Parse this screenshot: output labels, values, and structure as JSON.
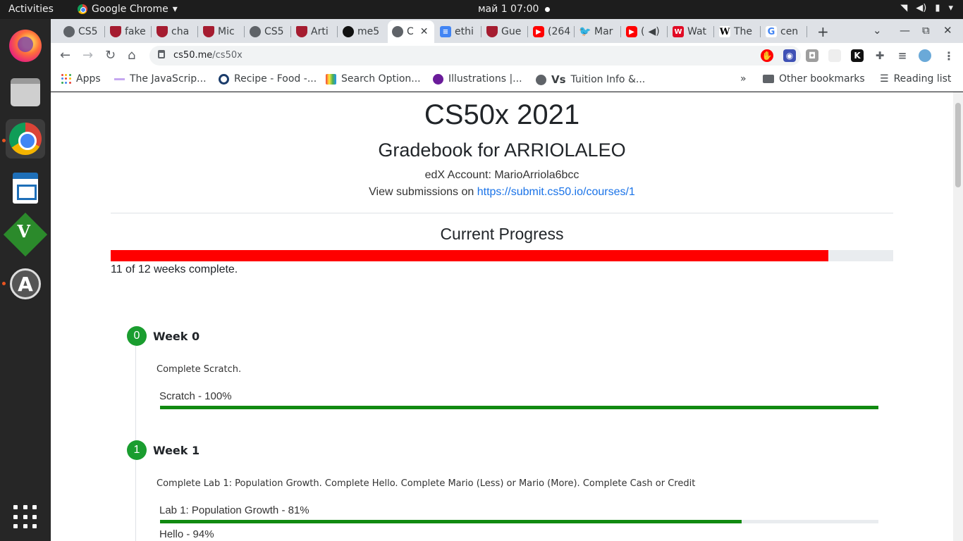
{
  "system": {
    "activities": "Activities",
    "app_name": "Google Chrome",
    "clock": "май 1  07:00"
  },
  "tabs": [
    {
      "label": "CS5",
      "icon": "globe-icon"
    },
    {
      "label": "fake",
      "icon": "harvard-shield-icon"
    },
    {
      "label": "cha",
      "icon": "harvard-shield-icon"
    },
    {
      "label": "Mic",
      "icon": "harvard-shield-icon"
    },
    {
      "label": "CS5",
      "icon": "globe-icon"
    },
    {
      "label": "Arti",
      "icon": "harvard-shield-icon"
    },
    {
      "label": "me5",
      "icon": "github-icon"
    },
    {
      "label": "C",
      "icon": "globe-icon",
      "active": true
    },
    {
      "label": "ethi",
      "icon": "docs-icon"
    },
    {
      "label": "Gue",
      "icon": "harvard-shield-icon"
    },
    {
      "label": "(264",
      "icon": "youtube-icon"
    },
    {
      "label": "Mar",
      "icon": "twitter-icon"
    },
    {
      "label": "(",
      "icon": "youtube-icon"
    },
    {
      "label": "Wat",
      "icon": "wat-icon"
    },
    {
      "label": "The",
      "icon": "wikipedia-icon"
    },
    {
      "label": "cen",
      "icon": "google-icon"
    }
  ],
  "toolbar": {
    "url_host": "cs50.me",
    "url_path": "/cs50x"
  },
  "bookmarks": {
    "apps": "Apps",
    "items": [
      "The JavaScrip...",
      "Recipe - Food -...",
      "Search Option...",
      "Illustrations |...",
      "Tuition Info &..."
    ],
    "more": "»",
    "other": "Other bookmarks",
    "reading_list": "Reading list"
  },
  "page": {
    "course_title": "CS50x 2021",
    "gradebook_title": "Gradebook for ARRIOLALEO",
    "edx_account": "edX Account: MarioArriola6bcc",
    "submissions_prefix": "View submissions on ",
    "submissions_link": "https://submit.cs50.io/courses/1",
    "progress_heading": "Current Progress",
    "progress_fraction": 0.9167,
    "progress_text": "11 of 12 weeks complete.",
    "colors": {
      "overall_bar": "#ff0000",
      "item_bar": "#118a11",
      "badge": "#1a9d2f"
    },
    "weeks": [
      {
        "number": "0",
        "title": "Week 0",
        "description": "Complete Scratch.",
        "items": [
          {
            "label": "Scratch - 100%",
            "percent": 100
          }
        ]
      },
      {
        "number": "1",
        "title": "Week 1",
        "description": "Complete Lab 1: Population Growth. Complete Hello. Complete Mario (Less) or Mario (More). Complete Cash or Credit",
        "items": [
          {
            "label": "Lab 1: Population Growth - 81%",
            "percent": 81
          },
          {
            "label": "Hello - 94%",
            "percent": 94
          }
        ]
      }
    ]
  }
}
